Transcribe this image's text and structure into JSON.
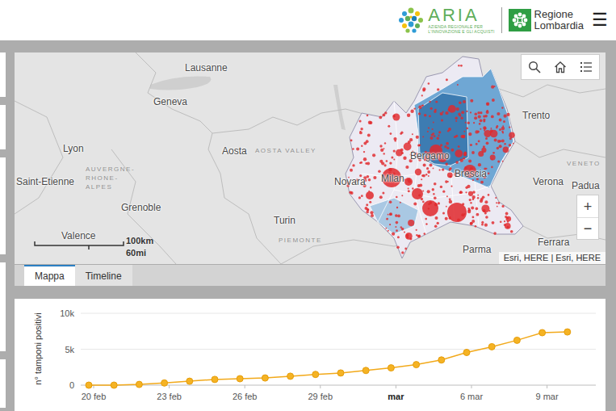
{
  "header": {
    "aria_logo": {
      "name": "ARIA",
      "subtitle_lines": [
        "AZIENDA REGIONALE PER",
        "L'INNOVAZIONE E GLI ACQUISTI"
      ]
    },
    "region_logo": {
      "lines": [
        "Regione",
        "Lombardia"
      ]
    },
    "menu_button": "☰"
  },
  "map": {
    "labels": [
      {
        "text": "Lausanne",
        "kind": "city"
      },
      {
        "text": "Geneva",
        "kind": "city"
      },
      {
        "text": "Lyon",
        "kind": "city"
      },
      {
        "text": "Aosta",
        "kind": "city"
      },
      {
        "text": "AOSTA VALLEY",
        "kind": "region"
      },
      {
        "text": "Saint-Etienne",
        "kind": "city"
      },
      {
        "text": "AUVERGNE-",
        "kind": "region"
      },
      {
        "text": "RHONE-",
        "kind": "region"
      },
      {
        "text": "ALPES",
        "kind": "region"
      },
      {
        "text": "Grenoble",
        "kind": "city"
      },
      {
        "text": "Valence",
        "kind": "city"
      },
      {
        "text": "Turin",
        "kind": "city"
      },
      {
        "text": "PIEMONTE",
        "kind": "region"
      },
      {
        "text": "Novara",
        "kind": "city"
      },
      {
        "text": "Milan",
        "kind": "city"
      },
      {
        "text": "Bergamo",
        "kind": "city"
      },
      {
        "text": "Brescia",
        "kind": "city"
      },
      {
        "text": "Trento",
        "kind": "city"
      },
      {
        "text": "Verona",
        "kind": "city"
      },
      {
        "text": "VENETO",
        "kind": "region"
      },
      {
        "text": "Padua",
        "kind": "city"
      },
      {
        "text": "Parma",
        "kind": "city"
      },
      {
        "text": "Ferrara",
        "kind": "city"
      }
    ],
    "scale": {
      "km": "100km",
      "mi": "60mi"
    },
    "attribution": "Esri, HERE | Esri, HERE",
    "zoom_in": "+",
    "zoom_out": "−"
  },
  "tabs": [
    {
      "label": "Mappa",
      "selected": true
    },
    {
      "label": "Timeline",
      "selected": false
    }
  ],
  "chart": {
    "y_axis_label": "n° tamponi positivi",
    "y_ticks": [
      "10k",
      "5k",
      "0"
    ],
    "x_ticks": [
      {
        "label": "20 feb",
        "major": false
      },
      {
        "label": "23 feb",
        "major": false
      },
      {
        "label": "26 feb",
        "major": false
      },
      {
        "label": "29 feb",
        "major": false
      },
      {
        "label": "mar",
        "major": true
      },
      {
        "label": "6 mar",
        "major": false
      },
      {
        "label": "9 mar",
        "major": false
      }
    ],
    "series": [
      {
        "values": [
          0,
          0,
          100,
          300,
          550,
          800,
          900,
          1000,
          1250,
          1500,
          1700,
          2050,
          2400,
          2850,
          3500,
          4550,
          5350,
          6250,
          7300,
          7400
        ]
      }
    ]
  }
}
